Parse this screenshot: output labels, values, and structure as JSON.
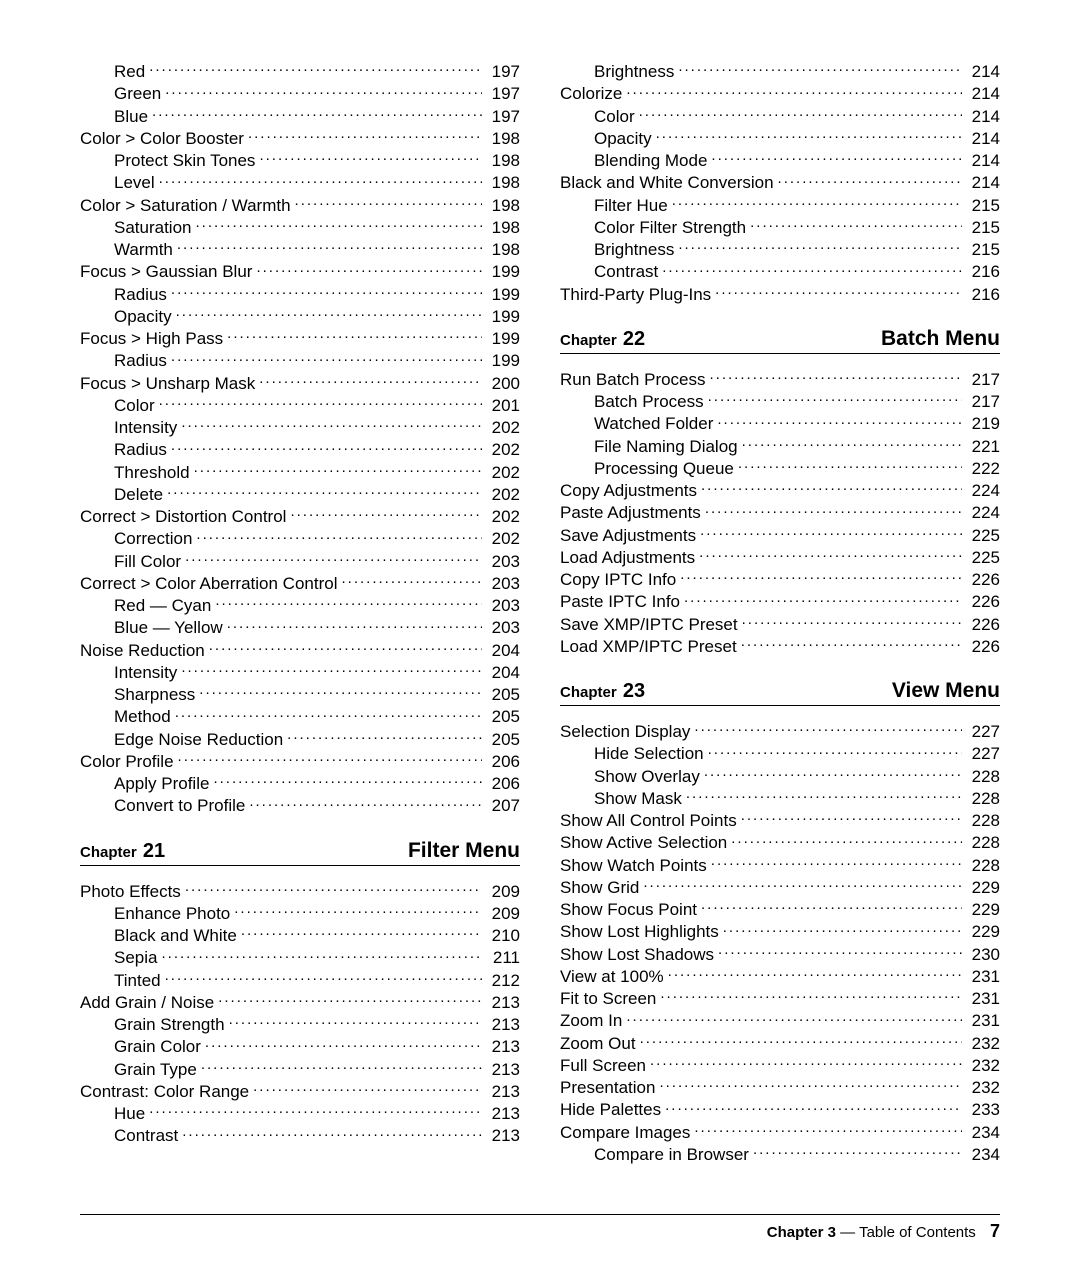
{
  "columns": [
    {
      "blocks": [
        {
          "type": "entries",
          "items": [
            {
              "label": "Red",
              "page": "197",
              "level": 1
            },
            {
              "label": "Green",
              "page": "197",
              "level": 1
            },
            {
              "label": "Blue",
              "page": "197",
              "level": 1
            },
            {
              "label": "Color > Color Booster",
              "page": "198",
              "level": 0
            },
            {
              "label": "Protect Skin Tones",
              "page": "198",
              "level": 1
            },
            {
              "label": "Level",
              "page": "198",
              "level": 1
            },
            {
              "label": "Color > Saturation / Warmth",
              "page": "198",
              "level": 0
            },
            {
              "label": "Saturation",
              "page": "198",
              "level": 1
            },
            {
              "label": "Warmth",
              "page": "198",
              "level": 1
            },
            {
              "label": "Focus > Gaussian Blur",
              "page": "199",
              "level": 0
            },
            {
              "label": "Radius",
              "page": "199",
              "level": 1
            },
            {
              "label": "Opacity",
              "page": "199",
              "level": 1
            },
            {
              "label": "Focus > High Pass",
              "page": "199",
              "level": 0
            },
            {
              "label": "Radius",
              "page": "199",
              "level": 1
            },
            {
              "label": "Focus > Unsharp Mask",
              "page": "200",
              "level": 0
            },
            {
              "label": "Color",
              "page": "201",
              "level": 1
            },
            {
              "label": "Intensity",
              "page": "202",
              "level": 1
            },
            {
              "label": "Radius",
              "page": "202",
              "level": 1
            },
            {
              "label": "Threshold",
              "page": "202",
              "level": 1
            },
            {
              "label": "Delete",
              "page": "202",
              "level": 1
            },
            {
              "label": "Correct > Distortion Control",
              "page": "202",
              "level": 0
            },
            {
              "label": "Correction",
              "page": "202",
              "level": 1
            },
            {
              "label": "Fill Color",
              "page": "203",
              "level": 1
            },
            {
              "label": "Correct > Color Aberration Control",
              "page": "203",
              "level": 0
            },
            {
              "label": "Red — Cyan",
              "page": "203",
              "level": 1
            },
            {
              "label": "Blue — Yellow",
              "page": "203",
              "level": 1
            },
            {
              "label": "Noise Reduction",
              "page": "204",
              "level": 0
            },
            {
              "label": "Intensity",
              "page": "204",
              "level": 1
            },
            {
              "label": "Sharpness",
              "page": "205",
              "level": 1
            },
            {
              "label": "Method",
              "page": "205",
              "level": 1
            },
            {
              "label": "Edge Noise Reduction",
              "page": "205",
              "level": 1
            },
            {
              "label": "Color Profile",
              "page": "206",
              "level": 0
            },
            {
              "label": "Apply Profile",
              "page": "206",
              "level": 1
            },
            {
              "label": "Convert to Profile",
              "page": "207",
              "level": 1
            }
          ]
        },
        {
          "type": "chapter",
          "chapter_word": "Chapter",
          "chapter_num": "21",
          "title": "Filter Menu"
        },
        {
          "type": "entries",
          "items": [
            {
              "label": "Photo Effects",
              "page": "209",
              "level": 0
            },
            {
              "label": "Enhance Photo",
              "page": "209",
              "level": 1
            },
            {
              "label": "Black and White",
              "page": "210",
              "level": 1
            },
            {
              "label": "Sepia",
              "page": "211",
              "level": 1
            },
            {
              "label": "Tinted",
              "page": "212",
              "level": 1
            },
            {
              "label": "Add Grain / Noise",
              "page": "213",
              "level": 0
            },
            {
              "label": "Grain Strength",
              "page": "213",
              "level": 1
            },
            {
              "label": "Grain Color",
              "page": "213",
              "level": 1
            },
            {
              "label": "Grain Type",
              "page": "213",
              "level": 1
            },
            {
              "label": "Contrast: Color Range",
              "page": "213",
              "level": 0
            },
            {
              "label": "Hue",
              "page": "213",
              "level": 1
            },
            {
              "label": "Contrast",
              "page": "213",
              "level": 1
            }
          ]
        }
      ]
    },
    {
      "blocks": [
        {
          "type": "entries",
          "items": [
            {
              "label": "Brightness",
              "page": "214",
              "level": 1
            },
            {
              "label": "Colorize",
              "page": "214",
              "level": 0
            },
            {
              "label": "Color",
              "page": "214",
              "level": 1
            },
            {
              "label": "Opacity",
              "page": "214",
              "level": 1
            },
            {
              "label": "Blending Mode",
              "page": "214",
              "level": 1
            },
            {
              "label": "Black and White Conversion",
              "page": "214",
              "level": 0
            },
            {
              "label": "Filter Hue",
              "page": "215",
              "level": 1
            },
            {
              "label": "Color Filter Strength",
              "page": "215",
              "level": 1
            },
            {
              "label": "Brightness",
              "page": "215",
              "level": 1
            },
            {
              "label": "Contrast",
              "page": "216",
              "level": 1
            },
            {
              "label": "Third-Party Plug-Ins",
              "page": "216",
              "level": 0
            }
          ]
        },
        {
          "type": "chapter",
          "chapter_word": "Chapter",
          "chapter_num": "22",
          "title": "Batch Menu"
        },
        {
          "type": "entries",
          "items": [
            {
              "label": "Run Batch Process",
              "page": "217",
              "level": 0
            },
            {
              "label": "Batch Process",
              "page": "217",
              "level": 1
            },
            {
              "label": "Watched Folder",
              "page": "219",
              "level": 1
            },
            {
              "label": "File Naming Dialog",
              "page": "221",
              "level": 1
            },
            {
              "label": "Processing Queue",
              "page": "222",
              "level": 1
            },
            {
              "label": "Copy Adjustments",
              "page": "224",
              "level": 0
            },
            {
              "label": "Paste Adjustments",
              "page": "224",
              "level": 0
            },
            {
              "label": "Save Adjustments",
              "page": "225",
              "level": 0
            },
            {
              "label": "Load Adjustments",
              "page": "225",
              "level": 0
            },
            {
              "label": "Copy IPTC Info",
              "page": "226",
              "level": 0
            },
            {
              "label": "Paste IPTC Info",
              "page": "226",
              "level": 0
            },
            {
              "label": "Save XMP/IPTC Preset",
              "page": "226",
              "level": 0
            },
            {
              "label": "Load XMP/IPTC Preset",
              "page": "226",
              "level": 0
            }
          ]
        },
        {
          "type": "chapter",
          "chapter_word": "Chapter",
          "chapter_num": "23",
          "title": "View Menu"
        },
        {
          "type": "entries",
          "items": [
            {
              "label": "Selection Display",
              "page": "227",
              "level": 0
            },
            {
              "label": "Hide Selection",
              "page": "227",
              "level": 1
            },
            {
              "label": "Show Overlay",
              "page": "228",
              "level": 1
            },
            {
              "label": "Show Mask",
              "page": "228",
              "level": 1
            },
            {
              "label": "Show All Control Points",
              "page": "228",
              "level": 0
            },
            {
              "label": "Show Active Selection",
              "page": "228",
              "level": 0
            },
            {
              "label": "Show Watch Points",
              "page": "228",
              "level": 0
            },
            {
              "label": "Show Grid",
              "page": "229",
              "level": 0
            },
            {
              "label": "Show Focus Point",
              "page": "229",
              "level": 0
            },
            {
              "label": "Show Lost Highlights",
              "page": "229",
              "level": 0
            },
            {
              "label": "Show Lost Shadows",
              "page": "230",
              "level": 0
            },
            {
              "label": "View at 100%",
              "page": "231",
              "level": 0
            },
            {
              "label": "Fit to Screen",
              "page": "231",
              "level": 0
            },
            {
              "label": "Zoom In",
              "page": "231",
              "level": 0
            },
            {
              "label": "Zoom Out",
              "page": "232",
              "level": 0
            },
            {
              "label": "Full Screen",
              "page": "232",
              "level": 0
            },
            {
              "label": "Presentation",
              "page": "232",
              "level": 0
            },
            {
              "label": "Hide Palettes",
              "page": "233",
              "level": 0
            },
            {
              "label": "Compare Images",
              "page": "234",
              "level": 0
            },
            {
              "label": "Compare in Browser",
              "page": "234",
              "level": 1
            }
          ]
        }
      ]
    }
  ],
  "footer": {
    "chapter_label": "Chapter 3",
    "separator": " — ",
    "section": "Table of Contents",
    "pagenum": "7"
  }
}
